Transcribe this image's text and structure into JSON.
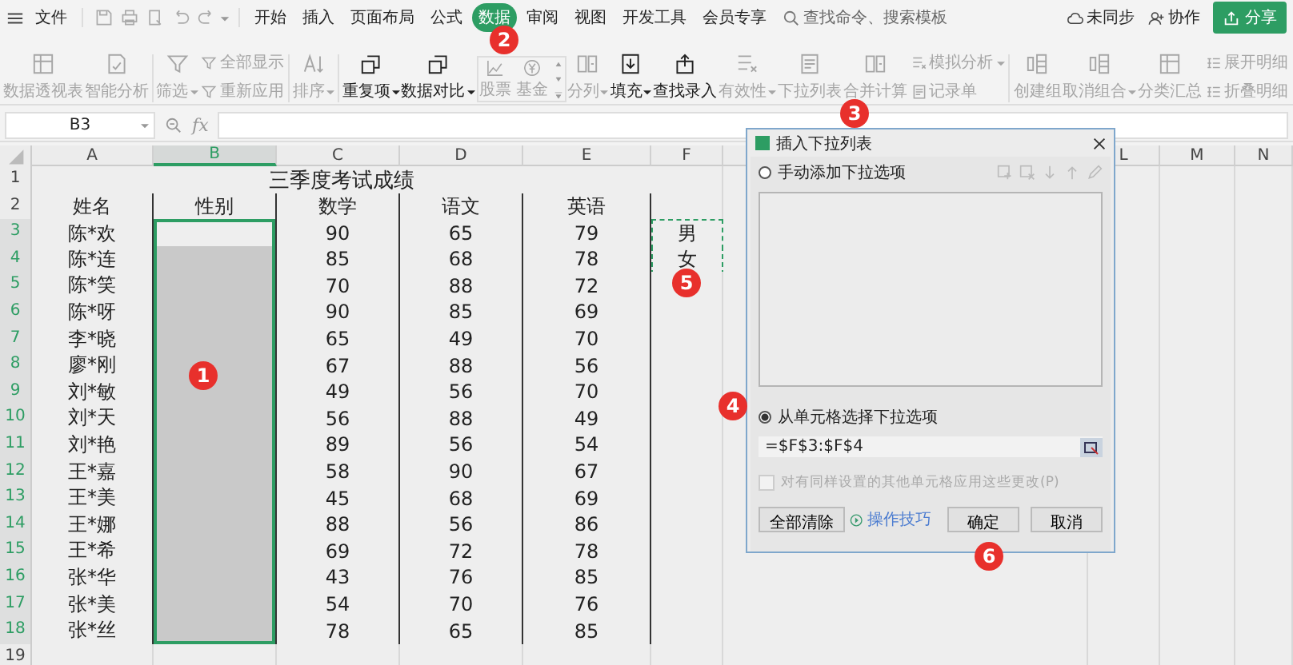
{
  "menu_bar": {
    "file": "文件",
    "tabs": [
      {
        "label": "开始",
        "selected": false
      },
      {
        "label": "插入",
        "selected": false
      },
      {
        "label": "页面布局",
        "selected": false
      },
      {
        "label": "公式",
        "selected": false
      },
      {
        "label": "数据",
        "selected": true
      },
      {
        "label": "审阅",
        "selected": false
      },
      {
        "label": "视图",
        "selected": false
      },
      {
        "label": "开发工具",
        "selected": false
      },
      {
        "label": "会员专享",
        "selected": false
      }
    ],
    "search": {
      "placeholder": "查找命令、搜索模板"
    },
    "sync": "未同步",
    "collaborate": "协作",
    "share": "分享"
  },
  "ribbon": [
    {
      "kind": "large",
      "label": "数据透视表",
      "dropdown": false,
      "disabled": true
    },
    {
      "kind": "large",
      "label": "智能分析",
      "dropdown": false,
      "disabled": true
    },
    {
      "kind": "separator"
    },
    {
      "kind": "large",
      "label": "筛选",
      "dropdown": true,
      "disabled": true
    },
    {
      "kind": "stack",
      "items": [
        {
          "label": "全部显示",
          "dropdown": false,
          "disabled": true
        },
        {
          "label": "重新应用",
          "dropdown": false,
          "disabled": true
        }
      ]
    },
    {
      "kind": "separator"
    },
    {
      "kind": "large",
      "label": "排序",
      "dropdown": true,
      "disabled": true
    },
    {
      "kind": "separator"
    },
    {
      "kind": "large",
      "label": "重复项",
      "dropdown": true,
      "disabled": false
    },
    {
      "kind": "large",
      "label": "数据对比",
      "dropdown": true,
      "disabled": false
    },
    {
      "kind": "gallery",
      "items": [
        {
          "label": "股票",
          "disabled": true
        },
        {
          "label": "基金",
          "disabled": true
        }
      ]
    },
    {
      "kind": "large",
      "label": "分列",
      "dropdown": true,
      "disabled": true
    },
    {
      "kind": "large",
      "label": "填充",
      "dropdown": true,
      "disabled": false
    },
    {
      "kind": "large",
      "label": "查找录入",
      "dropdown": false,
      "disabled": false
    },
    {
      "kind": "large",
      "label": "有效性",
      "dropdown": true,
      "disabled": true
    },
    {
      "kind": "large",
      "label": "下拉列表",
      "dropdown": false,
      "disabled": true
    },
    {
      "kind": "large",
      "label": "合并计算",
      "dropdown": false,
      "disabled": true
    },
    {
      "kind": "stack",
      "items": [
        {
          "label": "模拟分析",
          "dropdown": true,
          "disabled": true
        },
        {
          "label": "记录单",
          "dropdown": false,
          "disabled": true
        }
      ]
    },
    {
      "kind": "separator"
    },
    {
      "kind": "large",
      "label": "创建组",
      "dropdown": false,
      "disabled": true
    },
    {
      "kind": "large",
      "label": "取消组合",
      "dropdown": true,
      "disabled": true
    },
    {
      "kind": "large",
      "label": "分类汇总",
      "dropdown": false,
      "disabled": true
    },
    {
      "kind": "stack",
      "items": [
        {
          "label": "展开明细",
          "dropdown": false,
          "disabled": true
        },
        {
          "label": "折叠明细",
          "dropdown": false,
          "disabled": true
        }
      ]
    }
  ],
  "formula_bar": {
    "name_box": "B3",
    "fx": "fx"
  },
  "sheet": {
    "columns": [
      {
        "label": "A",
        "selected": false
      },
      {
        "label": "B",
        "selected": true
      },
      {
        "label": "C",
        "selected": false
      },
      {
        "label": "D",
        "selected": false
      },
      {
        "label": "E",
        "selected": false
      },
      {
        "label": "F",
        "selected": false
      },
      {
        "label": "L",
        "selected": false
      },
      {
        "label": "M",
        "selected": false
      },
      {
        "label": "N",
        "selected": false
      }
    ],
    "rows": [
      {
        "kind": "title",
        "num": "1",
        "title": "三季度考试成绩"
      },
      {
        "kind": "header",
        "num": "2",
        "cells": [
          "姓名",
          "性别",
          "数学",
          "语文",
          "英语"
        ]
      },
      {
        "kind": "data",
        "num": "3",
        "name": "陈*欢",
        "math": "90",
        "chinese": "65",
        "english": "79",
        "side": "男",
        "selected": true,
        "active": true,
        "marked": true
      },
      {
        "kind": "data",
        "num": "4",
        "name": "陈*连",
        "math": "85",
        "chinese": "68",
        "english": "78",
        "side": "女",
        "selected": true,
        "active": false,
        "marked": true
      },
      {
        "kind": "data",
        "num": "5",
        "name": "陈*笑",
        "math": "70",
        "chinese": "88",
        "english": "72",
        "selected": true,
        "active": false,
        "marked": false
      },
      {
        "kind": "data",
        "num": "6",
        "name": "陈*呀",
        "math": "90",
        "chinese": "85",
        "english": "69",
        "selected": true,
        "active": false,
        "marked": false
      },
      {
        "kind": "data",
        "num": "7",
        "name": "李*晓",
        "math": "65",
        "chinese": "49",
        "english": "70",
        "selected": true,
        "active": false,
        "marked": false
      },
      {
        "kind": "data",
        "num": "8",
        "name": "廖*刚",
        "math": "67",
        "chinese": "88",
        "english": "56",
        "selected": true,
        "active": false,
        "marked": false
      },
      {
        "kind": "data",
        "num": "9",
        "name": "刘*敏",
        "math": "49",
        "chinese": "56",
        "english": "70",
        "selected": true,
        "active": false,
        "marked": false
      },
      {
        "kind": "data",
        "num": "10",
        "name": "刘*天",
        "math": "56",
        "chinese": "88",
        "english": "49",
        "selected": true,
        "active": false,
        "marked": false
      },
      {
        "kind": "data",
        "num": "11",
        "name": "刘*艳",
        "math": "89",
        "chinese": "56",
        "english": "54",
        "selected": true,
        "active": false,
        "marked": false
      },
      {
        "kind": "data",
        "num": "12",
        "name": "王*嘉",
        "math": "58",
        "chinese": "90",
        "english": "67",
        "selected": true,
        "active": false,
        "marked": false
      },
      {
        "kind": "data",
        "num": "13",
        "name": "王*美",
        "math": "45",
        "chinese": "68",
        "english": "69",
        "selected": true,
        "active": false,
        "marked": false
      },
      {
        "kind": "data",
        "num": "14",
        "name": "王*娜",
        "math": "88",
        "chinese": "56",
        "english": "86",
        "selected": true,
        "active": false,
        "marked": false
      },
      {
        "kind": "data",
        "num": "15",
        "name": "王*希",
        "math": "69",
        "chinese": "72",
        "english": "78",
        "selected": true,
        "active": false,
        "marked": false
      },
      {
        "kind": "data",
        "num": "16",
        "name": "张*华",
        "math": "43",
        "chinese": "76",
        "english": "85",
        "selected": true,
        "active": false,
        "marked": false
      },
      {
        "kind": "data",
        "num": "17",
        "name": "张*美",
        "math": "54",
        "chinese": "70",
        "english": "76",
        "selected": true,
        "active": false,
        "marked": false
      },
      {
        "kind": "data",
        "num": "18",
        "name": "张*丝",
        "math": "78",
        "chinese": "65",
        "english": "85",
        "selected": true,
        "active": false,
        "marked": false
      },
      {
        "kind": "empty",
        "num": "19"
      }
    ]
  },
  "dialog": {
    "title": "插入下拉列表",
    "options": [
      {
        "label": "手动添加下拉选项",
        "selected": false
      },
      {
        "label": "从单元格选择下拉选项",
        "selected": true
      }
    ],
    "source": "=$F$3:$F$4",
    "apply_all": {
      "label": "对有同样设置的其他单元格应用这些更改(P)",
      "checked": false,
      "disabled": true
    },
    "clear_button": "全部清除",
    "tips_link": "操作技巧",
    "ok_button": "确定",
    "cancel_button": "取消"
  },
  "annotations": [
    {
      "label": "1"
    },
    {
      "label": "2"
    },
    {
      "label": "3"
    },
    {
      "label": "4"
    },
    {
      "label": "5"
    },
    {
      "label": "6"
    }
  ]
}
